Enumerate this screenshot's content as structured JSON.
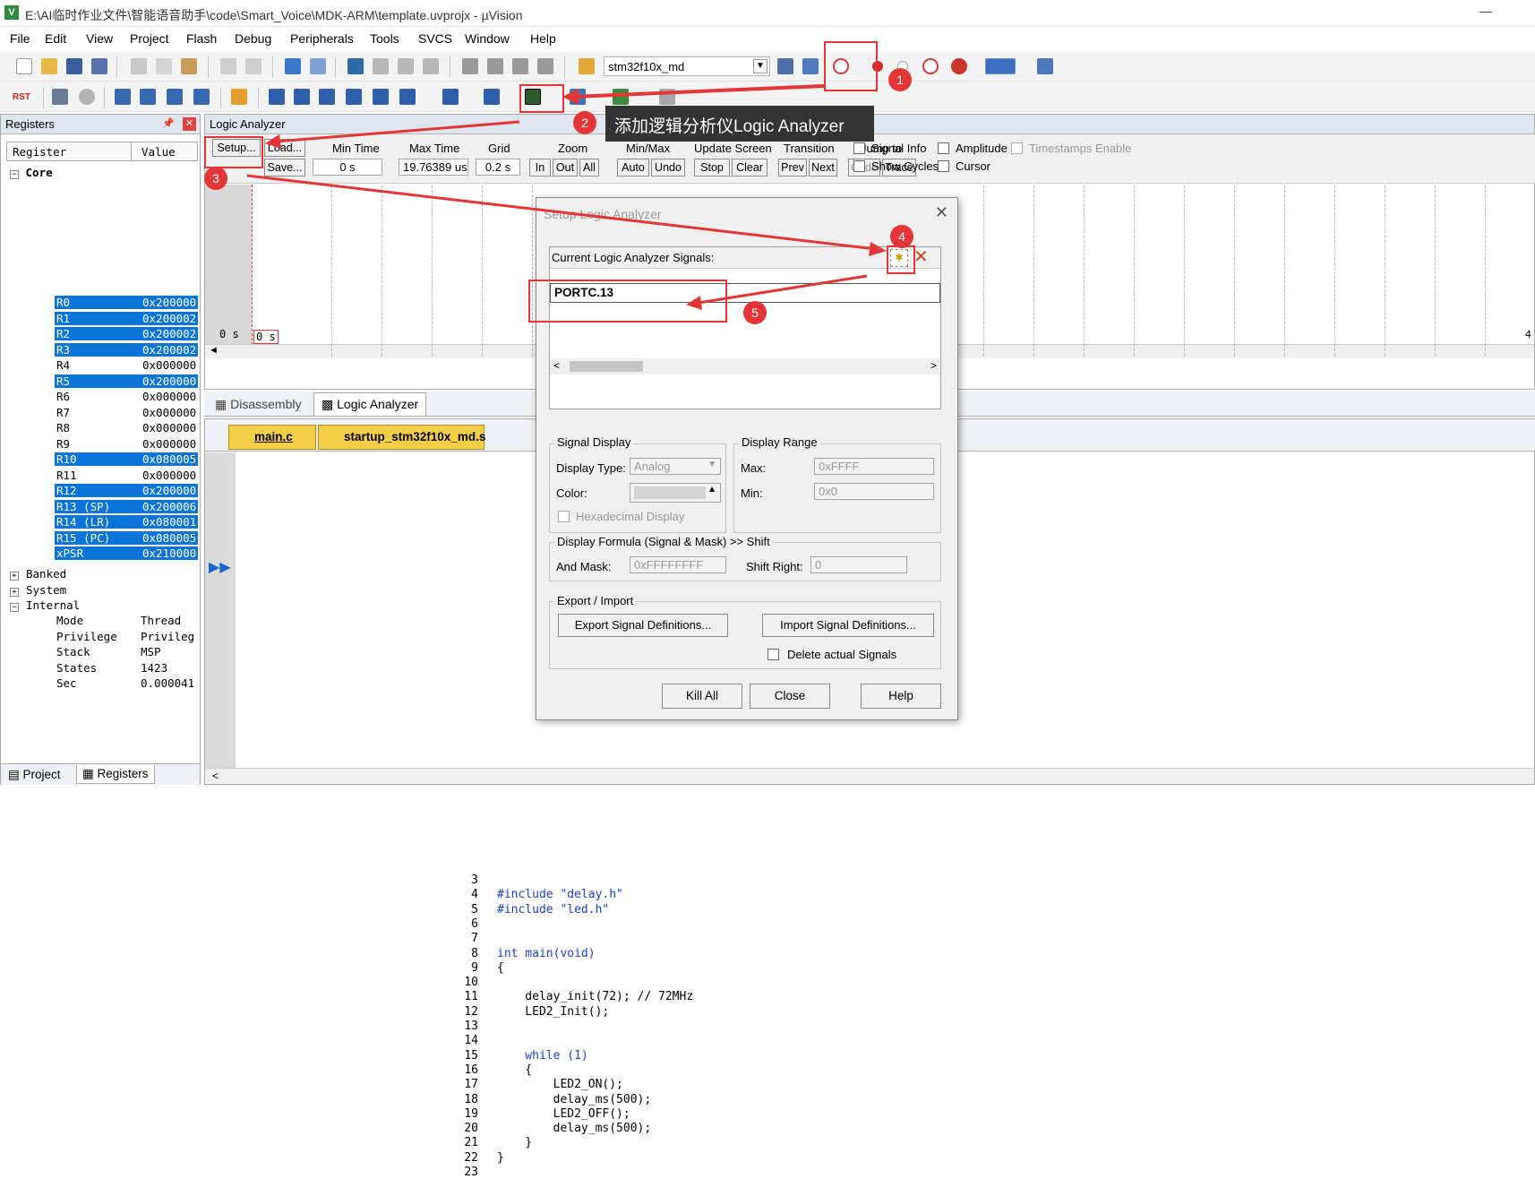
{
  "window": {
    "title": "E:\\AI临时作业文件\\智能语音助手\\code\\Smart_Voice\\MDK-ARM\\template.uvprojx - µVision",
    "app_icon_text": "V",
    "minimize": "—"
  },
  "menu": [
    "File",
    "Edit",
    "View",
    "Project",
    "Flash",
    "Debug",
    "Peripherals",
    "Tools",
    "SVCS",
    "Window",
    "Help"
  ],
  "toolbar": {
    "target_name": "stm32f10x_md",
    "rst_label": "RST"
  },
  "registers_panel": {
    "title": "Registers",
    "col_register": "Register",
    "col_value": "Value",
    "core_label": "Core",
    "rows": [
      {
        "name": "R0",
        "value": "0x200000",
        "selected": true
      },
      {
        "name": "R1",
        "value": "0x200002",
        "selected": true
      },
      {
        "name": "R2",
        "value": "0x200002",
        "selected": true
      },
      {
        "name": "R3",
        "value": "0x200002",
        "selected": true
      },
      {
        "name": "R4",
        "value": "0x000000",
        "selected": false
      },
      {
        "name": "R5",
        "value": "0x200000",
        "selected": true
      },
      {
        "name": "R6",
        "value": "0x000000",
        "selected": false
      },
      {
        "name": "R7",
        "value": "0x000000",
        "selected": false
      },
      {
        "name": "R8",
        "value": "0x000000",
        "selected": false
      },
      {
        "name": "R9",
        "value": "0x000000",
        "selected": false
      },
      {
        "name": "R10",
        "value": "0x080005",
        "selected": true
      },
      {
        "name": "R11",
        "value": "0x000000",
        "selected": false
      },
      {
        "name": "R12",
        "value": "0x200000",
        "selected": true
      },
      {
        "name": "R13 (SP)",
        "value": "0x200006",
        "selected": true
      },
      {
        "name": "R14 (LR)",
        "value": "0x080001",
        "selected": true
      },
      {
        "name": "R15 (PC)",
        "value": "0x080005",
        "selected": true
      },
      {
        "name": "xPSR",
        "value": "0x210000",
        "selected": true
      }
    ],
    "groups": [
      "Banked",
      "System",
      "Internal"
    ],
    "internal": [
      {
        "name": "Mode",
        "value": "Thread"
      },
      {
        "name": "Privilege",
        "value": "Privileg"
      },
      {
        "name": "Stack",
        "value": "MSP"
      },
      {
        "name": "States",
        "value": "1423"
      },
      {
        "name": "Sec",
        "value": "0.000041"
      }
    ],
    "bottom_tabs": [
      "Project",
      "Registers"
    ]
  },
  "logic_analyzer": {
    "title": "Logic Analyzer",
    "setup": "Setup...",
    "load": "Load...",
    "save": "Save...",
    "min_time_label": "Min Time",
    "min_time": "0 s",
    "max_time_label": "Max Time",
    "max_time": "19.76389 us",
    "grid_label": "Grid",
    "grid": "0.2 s",
    "zoom_label": "Zoom",
    "zoom_in": "In",
    "zoom_out": "Out",
    "zoom_all": "All",
    "minmax_label": "Min/Max",
    "auto": "Auto",
    "undo": "Undo",
    "update_label": "Update Screen",
    "stop": "Stop",
    "clear": "Clear",
    "transition_label": "Transition",
    "prev": "Prev",
    "next": "Next",
    "jumpto_label": "Jump to",
    "code": "Code",
    "trace": "Trace",
    "signal_info": "Signal Info",
    "amplitude": "Amplitude",
    "timestamps": "Timestamps Enable",
    "show_cycles": "Show Cycles",
    "cursor": "Cursor",
    "axis_start": "0 s",
    "cursor_time": "0 s",
    "axis_end": "4"
  },
  "view_tabs": [
    "Disassembly",
    "Logic Analyzer"
  ],
  "editor": {
    "files": [
      "main.c",
      "startup_stm32f10x_md.s"
    ],
    "lines": [
      {
        "n": "3",
        "code": ""
      },
      {
        "n": "4",
        "code": "#include \"delay.h\""
      },
      {
        "n": "5",
        "code": "#include \"led.h\""
      },
      {
        "n": "6",
        "code": ""
      },
      {
        "n": "7",
        "code": ""
      },
      {
        "n": "8",
        "code": "int main(void)"
      },
      {
        "n": "9",
        "code": "{"
      },
      {
        "n": "10",
        "code": ""
      },
      {
        "n": "11",
        "code": "    delay_init(72); // 72MHz"
      },
      {
        "n": "12",
        "code": "    LED2_Init();"
      },
      {
        "n": "13",
        "code": ""
      },
      {
        "n": "14",
        "code": ""
      },
      {
        "n": "15",
        "code": "    while (1)"
      },
      {
        "n": "16",
        "code": "    {"
      },
      {
        "n": "17",
        "code": "        LED2_ON();"
      },
      {
        "n": "18",
        "code": "        delay_ms(500);"
      },
      {
        "n": "19",
        "code": "        LED2_OFF();"
      },
      {
        "n": "20",
        "code": "        delay_ms(500);"
      },
      {
        "n": "21",
        "code": "    }"
      },
      {
        "n": "22",
        "code": "}"
      },
      {
        "n": "23",
        "code": ""
      }
    ]
  },
  "dialog": {
    "title": "Setup Logic Analyzer",
    "signals_label": "Current Logic Analyzer Signals:",
    "signal": "PORTC.13",
    "signal_display": "Signal Display",
    "display_type_label": "Display Type:",
    "display_type": "Analog",
    "color_label": "Color:",
    "hex_display": "Hexadecimal Display",
    "display_range": "Display Range",
    "max_label": "Max:",
    "max": "0xFFFF",
    "min_label": "Min:",
    "min": "0x0",
    "formula": "Display Formula (Signal & Mask) >> Shift",
    "and_mask_label": "And Mask:",
    "and_mask": "0xFFFFFFFF",
    "shift_right_label": "Shift Right:",
    "shift_right": "0",
    "export_import": "Export / Import",
    "export_btn": "Export Signal Definitions...",
    "import_btn": "Import Signal Definitions...",
    "delete_actual": "Delete actual Signals",
    "kill_all": "Kill All",
    "close": "Close",
    "help": "Help"
  },
  "annotations": {
    "tooltip": "添加逻辑分析仪Logic Analyzer",
    "badges": [
      "1",
      "2",
      "3",
      "4",
      "5"
    ],
    "color": "#e43636"
  }
}
